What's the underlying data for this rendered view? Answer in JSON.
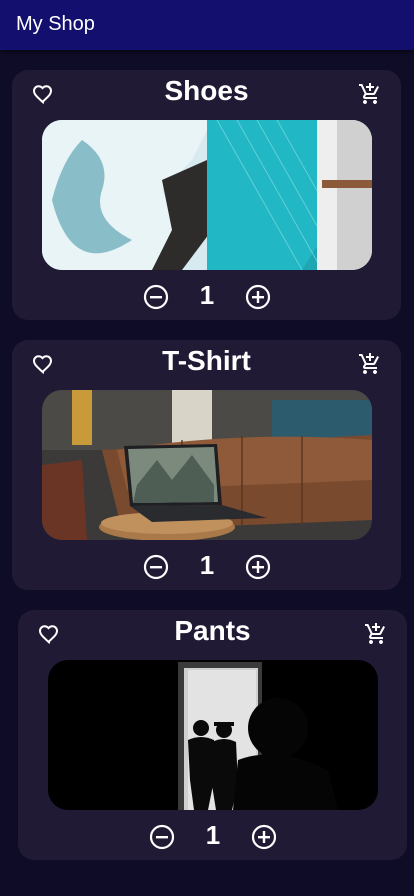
{
  "app": {
    "title": "My Shop"
  },
  "products": [
    {
      "name": "Shoes",
      "quantity": "1"
    },
    {
      "name": "T-Shirt",
      "quantity": "1"
    },
    {
      "name": "Pants",
      "quantity": "1"
    }
  ],
  "colors": {
    "appbar": "#120f6f",
    "background": "#0f0c27",
    "card": "#201a35",
    "text": "#ffffff"
  },
  "icons": [
    "heart-outline-icon",
    "add-to-cart-icon",
    "minus-circle-icon",
    "plus-circle-icon"
  ]
}
